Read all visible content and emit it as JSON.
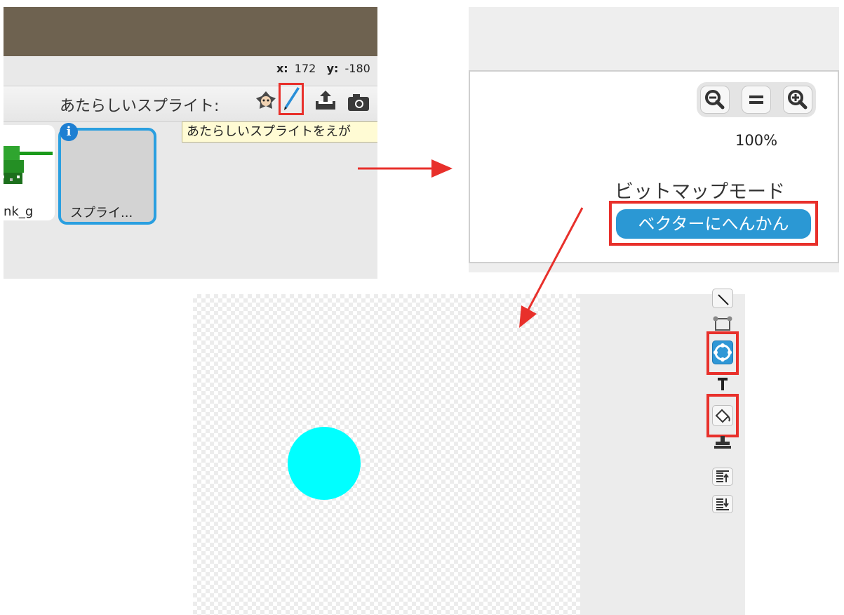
{
  "panel1": {
    "coords": {
      "x_label": "x:",
      "x_value": "172",
      "y_label": "y:",
      "y_value": "-180"
    },
    "new_sprite_label": "あたらしいスプライト:",
    "tooltip": "あたらしいスプライトをえが",
    "sprites": [
      {
        "name": "nk_g"
      },
      {
        "name": "スプライ..."
      }
    ],
    "info_badge": "i",
    "icons": [
      "sprite-library-icon",
      "paint-brush-icon",
      "upload-icon",
      "camera-icon"
    ]
  },
  "panel2": {
    "zoom_buttons": [
      "zoom-out-icon",
      "zoom-reset-icon",
      "zoom-in-icon"
    ],
    "zoom_level": "100%",
    "mode_label": "ビットマップモード",
    "convert_button": "ベクターにへんかん"
  },
  "panel3": {
    "circle_color": "#00ffff",
    "tools": [
      "line-tool-icon",
      "rectangle-tool-icon",
      "ellipse-tool-icon",
      "text-tool-icon",
      "fill-tool-icon",
      "stamp-tool-icon",
      "bring-front-icon",
      "send-back-icon"
    ]
  },
  "colors": {
    "highlight": "#e8302b",
    "accent": "#2b98d4",
    "arrow": "#e8302b"
  }
}
